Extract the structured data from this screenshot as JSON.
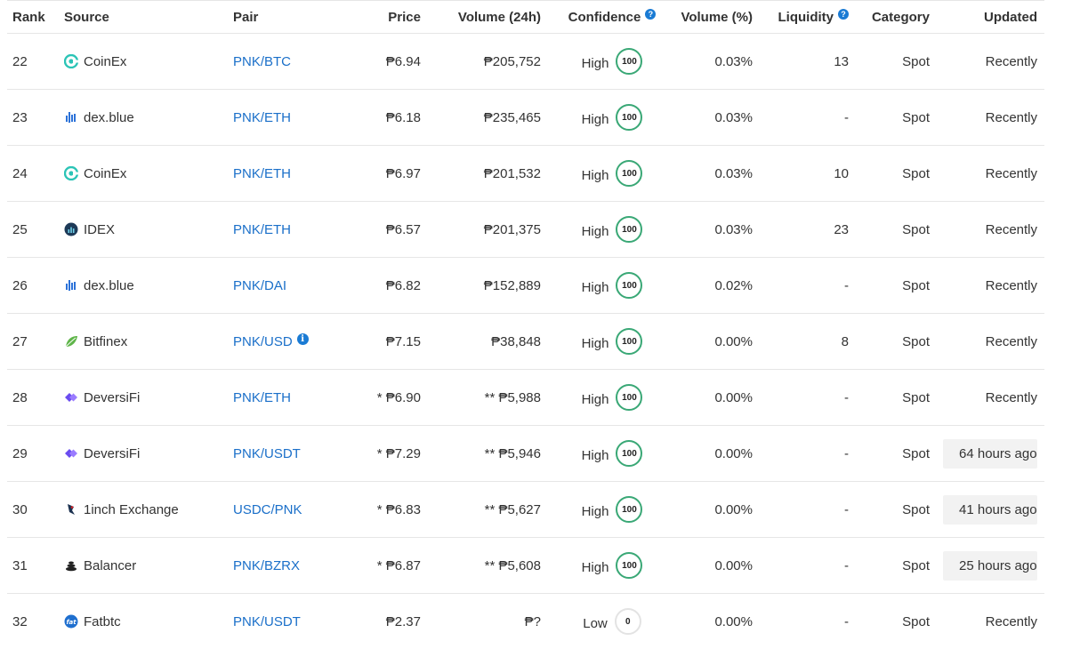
{
  "table": {
    "headers": {
      "rank": "Rank",
      "source": "Source",
      "pair": "Pair",
      "price": "Price",
      "volume": "Volume (24h)",
      "confidence": "Confidence",
      "volume_pct": "Volume (%)",
      "liquidity": "Liquidity",
      "category": "Category",
      "updated": "Updated"
    },
    "rows": [
      {
        "rank": "22",
        "source": "CoinEx",
        "source_icon": "coinex-icon",
        "pair": "PNK/BTC",
        "price": "₱6.94",
        "volume": "₱205,752",
        "confidence_label": "High",
        "confidence_score": "100",
        "volume_pct": "0.03%",
        "liquidity": "13",
        "category": "Spot",
        "updated": "Recently"
      },
      {
        "rank": "23",
        "source": "dex.blue",
        "source_icon": "dexblue-icon",
        "pair": "PNK/ETH",
        "price": "₱6.18",
        "volume": "₱235,465",
        "confidence_label": "High",
        "confidence_score": "100",
        "volume_pct": "0.03%",
        "liquidity": "-",
        "category": "Spot",
        "updated": "Recently"
      },
      {
        "rank": "24",
        "source": "CoinEx",
        "source_icon": "coinex-icon",
        "pair": "PNK/ETH",
        "price": "₱6.97",
        "volume": "₱201,532",
        "confidence_label": "High",
        "confidence_score": "100",
        "volume_pct": "0.03%",
        "liquidity": "10",
        "category": "Spot",
        "updated": "Recently"
      },
      {
        "rank": "25",
        "source": "IDEX",
        "source_icon": "idex-icon",
        "pair": "PNK/ETH",
        "price": "₱6.57",
        "volume": "₱201,375",
        "confidence_label": "High",
        "confidence_score": "100",
        "volume_pct": "0.03%",
        "liquidity": "23",
        "category": "Spot",
        "updated": "Recently"
      },
      {
        "rank": "26",
        "source": "dex.blue",
        "source_icon": "dexblue-icon",
        "pair": "PNK/DAI",
        "price": "₱6.82",
        "volume": "₱152,889",
        "confidence_label": "High",
        "confidence_score": "100",
        "volume_pct": "0.02%",
        "liquidity": "-",
        "category": "Spot",
        "updated": "Recently"
      },
      {
        "rank": "27",
        "source": "Bitfinex",
        "source_icon": "bitfinex-icon",
        "pair": "PNK/USD",
        "pair_info": "i",
        "price": "₱7.15",
        "volume": "₱38,848",
        "confidence_label": "High",
        "confidence_score": "100",
        "volume_pct": "0.00%",
        "liquidity": "8",
        "category": "Spot",
        "updated": "Recently"
      },
      {
        "rank": "28",
        "source": "DeversiFi",
        "source_icon": "deversifi-icon",
        "pair": "PNK/ETH",
        "price": "* ₱6.90",
        "volume": "** ₱5,988",
        "confidence_label": "High",
        "confidence_score": "100",
        "volume_pct": "0.00%",
        "liquidity": "-",
        "category": "Spot",
        "updated": "Recently"
      },
      {
        "rank": "29",
        "source": "DeversiFi",
        "source_icon": "deversifi-icon",
        "pair": "PNK/USDT",
        "price": "* ₱7.29",
        "volume": "** ₱5,946",
        "confidence_label": "High",
        "confidence_score": "100",
        "volume_pct": "0.00%",
        "liquidity": "-",
        "category": "Spot",
        "updated": "64 hours ago",
        "stale": true
      },
      {
        "rank": "30",
        "source": "1inch Exchange",
        "source_icon": "1inch-icon",
        "pair": "USDC/PNK",
        "price": "* ₱6.83",
        "volume": "** ₱5,627",
        "confidence_label": "High",
        "confidence_score": "100",
        "volume_pct": "0.00%",
        "liquidity": "-",
        "category": "Spot",
        "updated": "41 hours ago",
        "stale": true
      },
      {
        "rank": "31",
        "source": "Balancer",
        "source_icon": "balancer-icon",
        "pair": "PNK/BZRX",
        "price": "* ₱6.87",
        "volume": "** ₱5,608",
        "confidence_label": "High",
        "confidence_score": "100",
        "volume_pct": "0.00%",
        "liquidity": "-",
        "category": "Spot",
        "updated": "25 hours ago",
        "stale": true
      },
      {
        "rank": "32",
        "source": "Fatbtc",
        "source_icon": "fatbtc-icon",
        "pair": "PNK/USDT",
        "price": "₱2.37",
        "volume": "₱?",
        "confidence_label": "Low",
        "confidence_score": "0",
        "volume_pct": "0.00%",
        "liquidity": "-",
        "category": "Spot",
        "updated": "Recently"
      }
    ]
  },
  "colors": {
    "link": "#1a6fc9",
    "confidence_high": "#3aa876",
    "confidence_low": "#e3e3e3",
    "help_icon": "#1a7bd4"
  }
}
